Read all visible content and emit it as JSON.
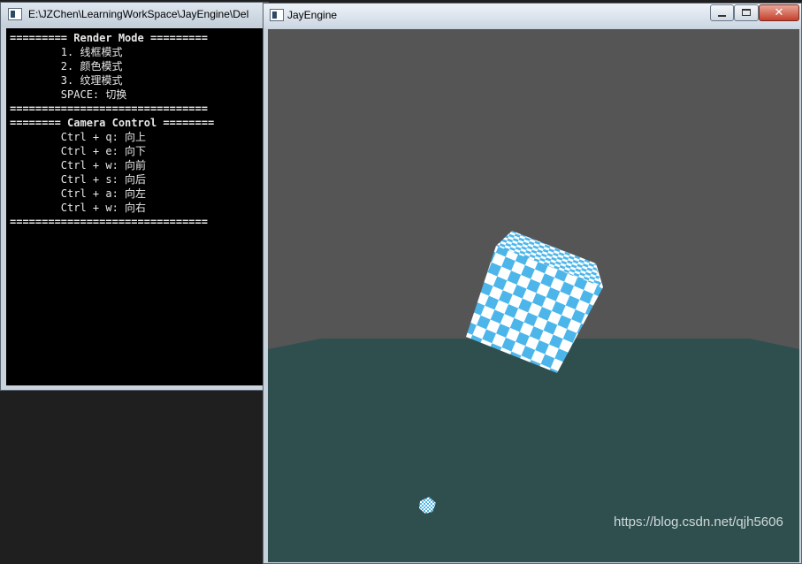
{
  "console": {
    "title": "E:\\JZChen\\LearningWorkSpace\\JayEngine\\Del",
    "lines": [
      "========= Render Mode =========",
      "        1. 线框模式",
      "        2. 颜色模式",
      "        3. 纹理模式",
      "        SPACE: 切换",
      "===============================",
      "======== Camera Control ========",
      "        Ctrl + q: 向上",
      "        Ctrl + e: 向下",
      "        Ctrl + w: 向前",
      "        Ctrl + s: 向后",
      "        Ctrl + a: 向左",
      "        Ctrl + w: 向右",
      "==============================="
    ]
  },
  "engine": {
    "title": "JayEngine",
    "close_glyph": "✕"
  },
  "scene": {
    "sky_color": "#555555",
    "ground_color": "#2f4f4f",
    "checker_color": "#4cb6ea",
    "checker_alt": "#ffffff"
  },
  "watermark": "https://blog.csdn.net/qjh5606",
  "icons": [
    "console-app-icon",
    "engine-app-icon",
    "minimize-icon",
    "maximize-icon",
    "close-icon"
  ]
}
